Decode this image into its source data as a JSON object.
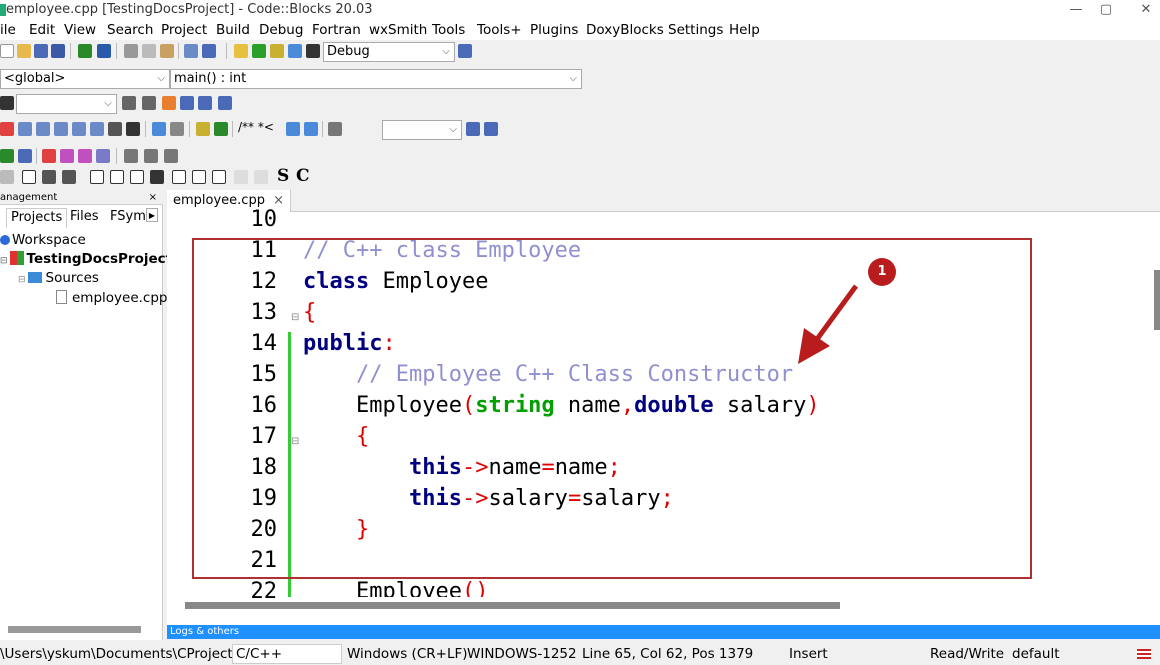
{
  "window": {
    "title": "employee.cpp [TestingDocsProject] - Code::Blocks 20.03"
  },
  "menu": [
    "ile",
    "Edit",
    "View",
    "Search",
    "Project",
    "Build",
    "Debug",
    "Fortran",
    "wxSmith",
    "Tools",
    "Tools+",
    "Plugins",
    "DoxyBlocks",
    "Settings",
    "Help"
  ],
  "toolbar": {
    "build_target": "Debug",
    "scope": "<global>",
    "function": "main() : int",
    "search_text": "",
    "doxy_comment": "/** *<",
    "text_s": "S",
    "text_c": "C"
  },
  "management": {
    "title": "anagement",
    "tabs": [
      "Projects",
      "Files",
      "FSym"
    ],
    "tree": {
      "workspace": "Workspace",
      "project": "TestingDocsProject",
      "folder": "Sources",
      "file": "employee.cpp"
    }
  },
  "editor": {
    "tab": "employee.cpp",
    "line_numbers": [
      "10",
      "11",
      "12",
      "13",
      "14",
      "15",
      "16",
      "17",
      "18",
      "19",
      "20",
      "21",
      "22"
    ],
    "annotation_number": "1"
  },
  "logs": {
    "label": "Logs & others"
  },
  "status": {
    "path": "\\Users\\yskum\\Documents\\CProjects\\...",
    "language": "C/C++",
    "eol": "Windows (CR+LF)",
    "encoding": "WINDOWS-1252",
    "position": "Line 65, Col 62, Pos 1379",
    "mode": "Insert",
    "access": "Read/Write",
    "profile": "default"
  },
  "colors": {
    "comment": "#9090d0",
    "keyword": "#000080",
    "type": "#00a000",
    "operator": "#e00000",
    "highlight_box": "#b03030",
    "badge": "#b81c1c"
  }
}
